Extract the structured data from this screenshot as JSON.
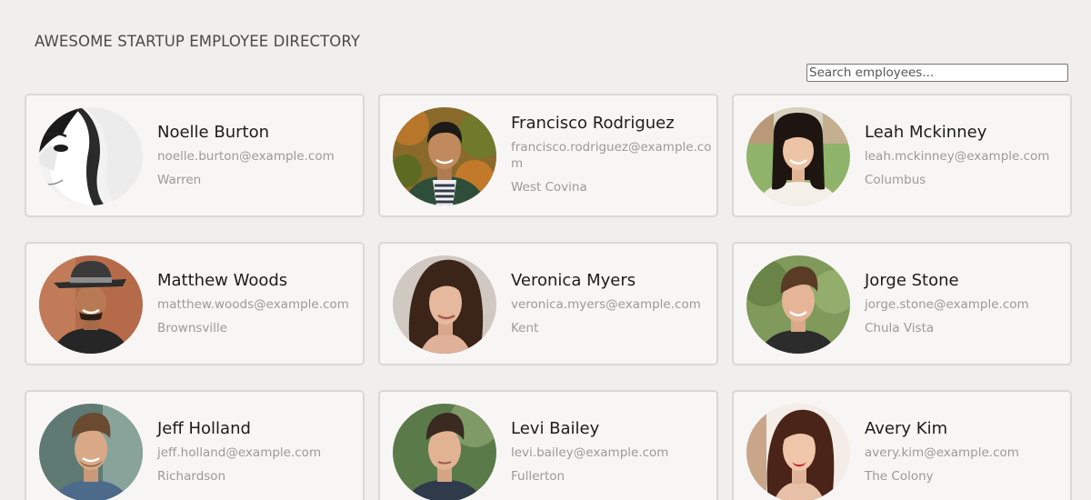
{
  "header": {
    "title": "AWESOME STARTUP EMPLOYEE DIRECTORY"
  },
  "search": {
    "placeholder": "Search employees..."
  },
  "employees": [
    {
      "name": "Noelle Burton",
      "email": "noelle.burton@example.com",
      "city": "Warren"
    },
    {
      "name": "Francisco Rodriguez",
      "email": "francisco.rodriguez@example.com",
      "city": "West Covina"
    },
    {
      "name": "Leah Mckinney",
      "email": "leah.mckinney@example.com",
      "city": "Columbus"
    },
    {
      "name": "Matthew Woods",
      "email": "matthew.woods@example.com",
      "city": "Brownsville"
    },
    {
      "name": "Veronica Myers",
      "email": "veronica.myers@example.com",
      "city": "Kent"
    },
    {
      "name": "Jorge Stone",
      "email": "jorge.stone@example.com",
      "city": "Chula Vista"
    },
    {
      "name": "Jeff Holland",
      "email": "jeff.holland@example.com",
      "city": "Richardson"
    },
    {
      "name": "Levi Bailey",
      "email": "levi.bailey@example.com",
      "city": "Fullerton"
    },
    {
      "name": "Avery Kim",
      "email": "avery.kim@example.com",
      "city": "The Colony"
    }
  ]
}
